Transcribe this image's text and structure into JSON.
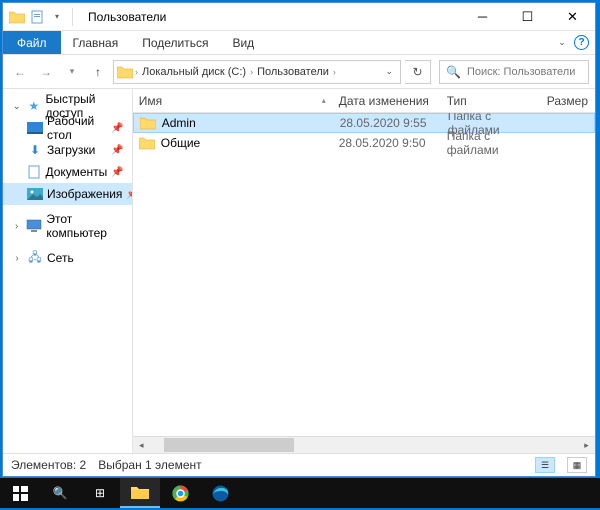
{
  "titlebar": {
    "title": "Пользователи"
  },
  "ribbon": {
    "file": "Файл",
    "tabs": [
      "Главная",
      "Поделиться",
      "Вид"
    ]
  },
  "address": {
    "crumbs": [
      "Локальный диск (C:)",
      "Пользователи"
    ],
    "search_placeholder": "Поиск: Пользователи"
  },
  "sidebar": {
    "quick": {
      "label": "Быстрый доступ",
      "expanded": true
    },
    "quick_items": [
      {
        "label": "Рабочий стол",
        "icon": "desktop",
        "pinned": true
      },
      {
        "label": "Загрузки",
        "icon": "downloads",
        "pinned": true
      },
      {
        "label": "Документы",
        "icon": "documents",
        "pinned": true
      },
      {
        "label": "Изображения",
        "icon": "pictures",
        "pinned": true,
        "selected": true
      }
    ],
    "thispc": {
      "label": "Этот компьютер"
    },
    "network": {
      "label": "Сеть"
    }
  },
  "columns": {
    "name": "Имя",
    "date": "Дата изменения",
    "type": "Тип",
    "size": "Размер"
  },
  "rows": [
    {
      "name": "Admin",
      "date": "28.05.2020 9:55",
      "type": "Папка с файлами",
      "selected": true
    },
    {
      "name": "Общие",
      "date": "28.05.2020 9:50",
      "type": "Папка с файлами",
      "selected": false
    }
  ],
  "status": {
    "count": "Элементов: 2",
    "selected": "Выбран 1 элемент"
  }
}
